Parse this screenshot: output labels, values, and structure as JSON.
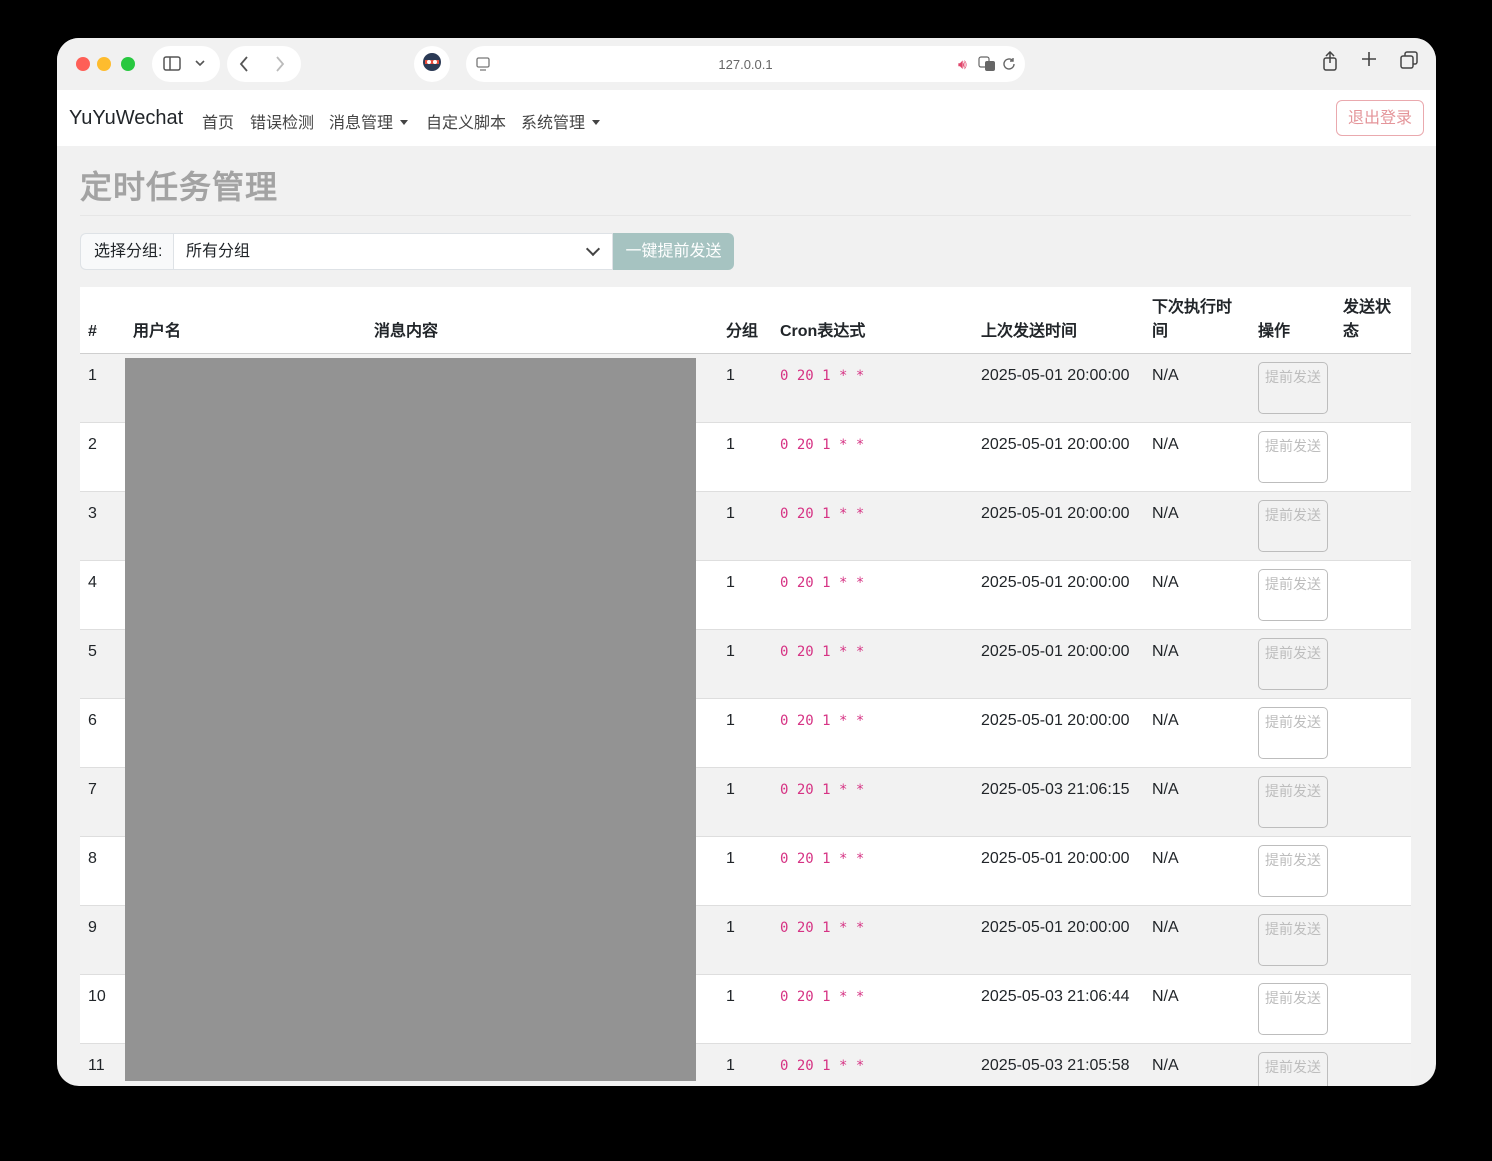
{
  "browser": {
    "url": "127.0.0.1"
  },
  "navbar": {
    "brand": "YuYuWechat",
    "items": [
      {
        "label": "首页"
      },
      {
        "label": "错误检测"
      },
      {
        "label": "消息管理",
        "dropdown": true
      },
      {
        "label": "自定义脚本"
      },
      {
        "label": "系统管理",
        "dropdown": true
      }
    ],
    "logout": "退出登录"
  },
  "page": {
    "title": "定时任务管理",
    "group_label": "选择分组:",
    "group_selected": "所有分组",
    "send_all": "一键提前发送"
  },
  "table": {
    "columns": [
      "#",
      "用户名",
      "消息内容",
      "分组",
      "Cron表达式",
      "上次发送时间",
      "下次执行时间",
      "操作",
      "发送状态"
    ],
    "action_label": "提前发送",
    "rows": [
      {
        "index": "1",
        "group": "1",
        "cron": "0 20 1 * *",
        "last_sent": "2025-05-01 20:00:00",
        "next_run": "N/A"
      },
      {
        "index": "2",
        "group": "1",
        "cron": "0 20 1 * *",
        "last_sent": "2025-05-01 20:00:00",
        "next_run": "N/A"
      },
      {
        "index": "3",
        "group": "1",
        "cron": "0 20 1 * *",
        "last_sent": "2025-05-01 20:00:00",
        "next_run": "N/A"
      },
      {
        "index": "4",
        "group": "1",
        "cron": "0 20 1 * *",
        "last_sent": "2025-05-01 20:00:00",
        "next_run": "N/A"
      },
      {
        "index": "5",
        "group": "1",
        "cron": "0 20 1 * *",
        "last_sent": "2025-05-01 20:00:00",
        "next_run": "N/A"
      },
      {
        "index": "6",
        "group": "1",
        "cron": "0 20 1 * *",
        "last_sent": "2025-05-01 20:00:00",
        "next_run": "N/A"
      },
      {
        "index": "7",
        "group": "1",
        "cron": "0 20 1 * *",
        "last_sent": "2025-05-03 21:06:15",
        "next_run": "N/A"
      },
      {
        "index": "8",
        "group": "1",
        "cron": "0 20 1 * *",
        "last_sent": "2025-05-01 20:00:00",
        "next_run": "N/A"
      },
      {
        "index": "9",
        "group": "1",
        "cron": "0 20 1 * *",
        "last_sent": "2025-05-01 20:00:00",
        "next_run": "N/A"
      },
      {
        "index": "10",
        "group": "1",
        "cron": "0 20 1 * *",
        "last_sent": "2025-05-03 21:06:44",
        "next_run": "N/A"
      },
      {
        "index": "11",
        "group": "1",
        "cron": "0 20 1 * *",
        "last_sent": "2025-05-03 21:05:58",
        "next_run": "N/A"
      }
    ]
  }
}
